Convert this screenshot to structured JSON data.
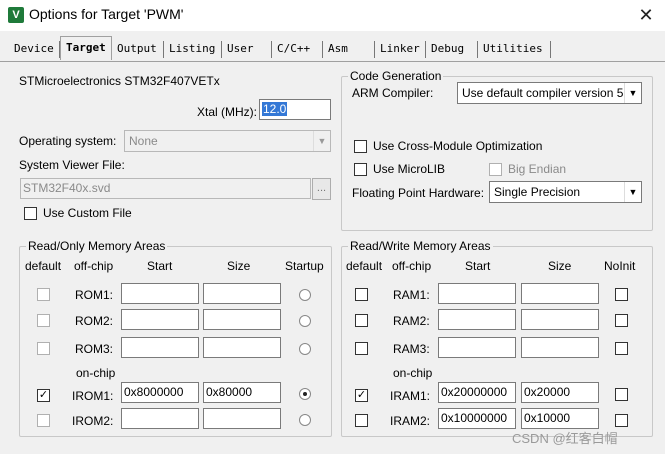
{
  "window": {
    "title": "Options for Target 'PWM'",
    "close_glyph": "✕",
    "icon": "keil-app-icon"
  },
  "tabs": [
    {
      "label": "Device"
    },
    {
      "label": "Target"
    },
    {
      "label": "Output"
    },
    {
      "label": "Listing"
    },
    {
      "label": "User"
    },
    {
      "label": "C/C++"
    },
    {
      "label": "Asm"
    },
    {
      "label": "Linker"
    },
    {
      "label": "Debug"
    },
    {
      "label": "Utilities"
    }
  ],
  "target": {
    "device_name": "STMicroelectronics STM32F407VETx",
    "xtal_label": "Xtal (MHz):",
    "xtal_value": "12.0",
    "os_label": "Operating system:",
    "os_value": "None",
    "svd_label": "System Viewer File:",
    "svd_value": "STM32F40x.svd",
    "browse_label": "...",
    "custom_file_label": "Use Custom File"
  },
  "code_generation": {
    "legend": "Code Generation",
    "compiler_label": "ARM Compiler:",
    "compiler_value": "Use default compiler version 5",
    "cross_module_label": "Use Cross-Module Optimization",
    "microlib_label": "Use MicroLIB",
    "big_endian_label": "Big Endian",
    "fpu_label": "Floating Point Hardware:",
    "fpu_value": "Single Precision"
  },
  "rom": {
    "legend": "Read/Only Memory Areas",
    "headers": [
      "default",
      "off-chip",
      "Start",
      "Size",
      "Startup"
    ],
    "on_chip_label": "on-chip",
    "rows": [
      {
        "name": "ROM1:",
        "start": "",
        "size": "",
        "default": false,
        "startup": false
      },
      {
        "name": "ROM2:",
        "start": "",
        "size": "",
        "default": false,
        "startup": false
      },
      {
        "name": "ROM3:",
        "start": "",
        "size": "",
        "default": false,
        "startup": false
      },
      {
        "name": "IROM1:",
        "start": "0x8000000",
        "size": "0x80000",
        "default": true,
        "startup": true
      },
      {
        "name": "IROM2:",
        "start": "",
        "size": "",
        "default": false,
        "startup": false
      }
    ]
  },
  "ram": {
    "legend": "Read/Write Memory Areas",
    "headers": [
      "default",
      "off-chip",
      "Start",
      "Size",
      "NoInit"
    ],
    "on_chip_label": "on-chip",
    "rows": [
      {
        "name": "RAM1:",
        "start": "",
        "size": "",
        "default": false,
        "noinit": false
      },
      {
        "name": "RAM2:",
        "start": "",
        "size": "",
        "default": false,
        "noinit": false
      },
      {
        "name": "RAM3:",
        "start": "",
        "size": "",
        "default": false,
        "noinit": false
      },
      {
        "name": "IRAM1:",
        "start": "0x20000000",
        "size": "0x20000",
        "default": true,
        "noinit": false
      },
      {
        "name": "IRAM2:",
        "start": "0x10000000",
        "size": "0x10000",
        "default": false,
        "noinit": false
      }
    ]
  },
  "watermark": "CSDN @红客白帽",
  "checkmark_glyph": "✓"
}
